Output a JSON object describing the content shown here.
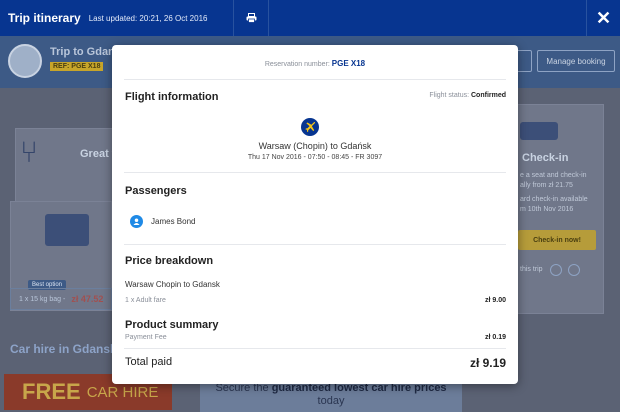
{
  "topbar": {
    "title": "Trip itinerary",
    "updated": "Last updated: 20:21, 26 Oct 2016"
  },
  "background": {
    "trip_title": "Trip to Gdansk",
    "ref": "REF: PGE X18",
    "manage_booking": "Manage booking",
    "great": "Great v",
    "best_option": "Best option",
    "bag_label": "1 x 15 kg bag -",
    "bag_price": "zł 47.52",
    "checkin_title": "Check-in",
    "checkin_line1": "e a seat and check-in",
    "checkin_line2": "ally from zł 21.75",
    "checkin_line3": "ard check-in available",
    "checkin_line4": "m 10th Nov 2016",
    "checkin_button": "Check-in now!",
    "share": "this trip",
    "car_hire": "Car hire in Gdansk",
    "free": "FREE",
    "car_hire_banner": "CAR HIRE",
    "secure_pre": "Secure the",
    "secure_bold": "guaranteed lowest car hire prices",
    "secure_post": "today"
  },
  "modal": {
    "reservation_label": "Reservation number:",
    "reservation_number": "PGE X18",
    "flight_info_title": "Flight information",
    "flight_status_label": "Flight status:",
    "flight_status": "Confirmed",
    "route": "Warsaw (Chopin) to Gdańsk",
    "flight_details": "Thu 17 Nov 2016 - 07:50 - 08:45 - FR 3097",
    "passengers_title": "Passengers",
    "passenger_name": "James Bond",
    "price_title": "Price breakdown",
    "price_route": "Warsaw Chopin to Gdansk",
    "fare_label": "1 x Adult fare",
    "fare_value": "zł 9.00",
    "product_title": "Product summary",
    "fee_label": "Payment Fee",
    "fee_value": "zł 0.19",
    "total_label": "Total paid",
    "total_value": "zł 9.19"
  },
  "colors": {
    "brand": "#073590",
    "accent": "#1f8ae6"
  },
  "icons": [
    "print-icon",
    "close-icon",
    "plane-icon",
    "user-icon"
  ]
}
